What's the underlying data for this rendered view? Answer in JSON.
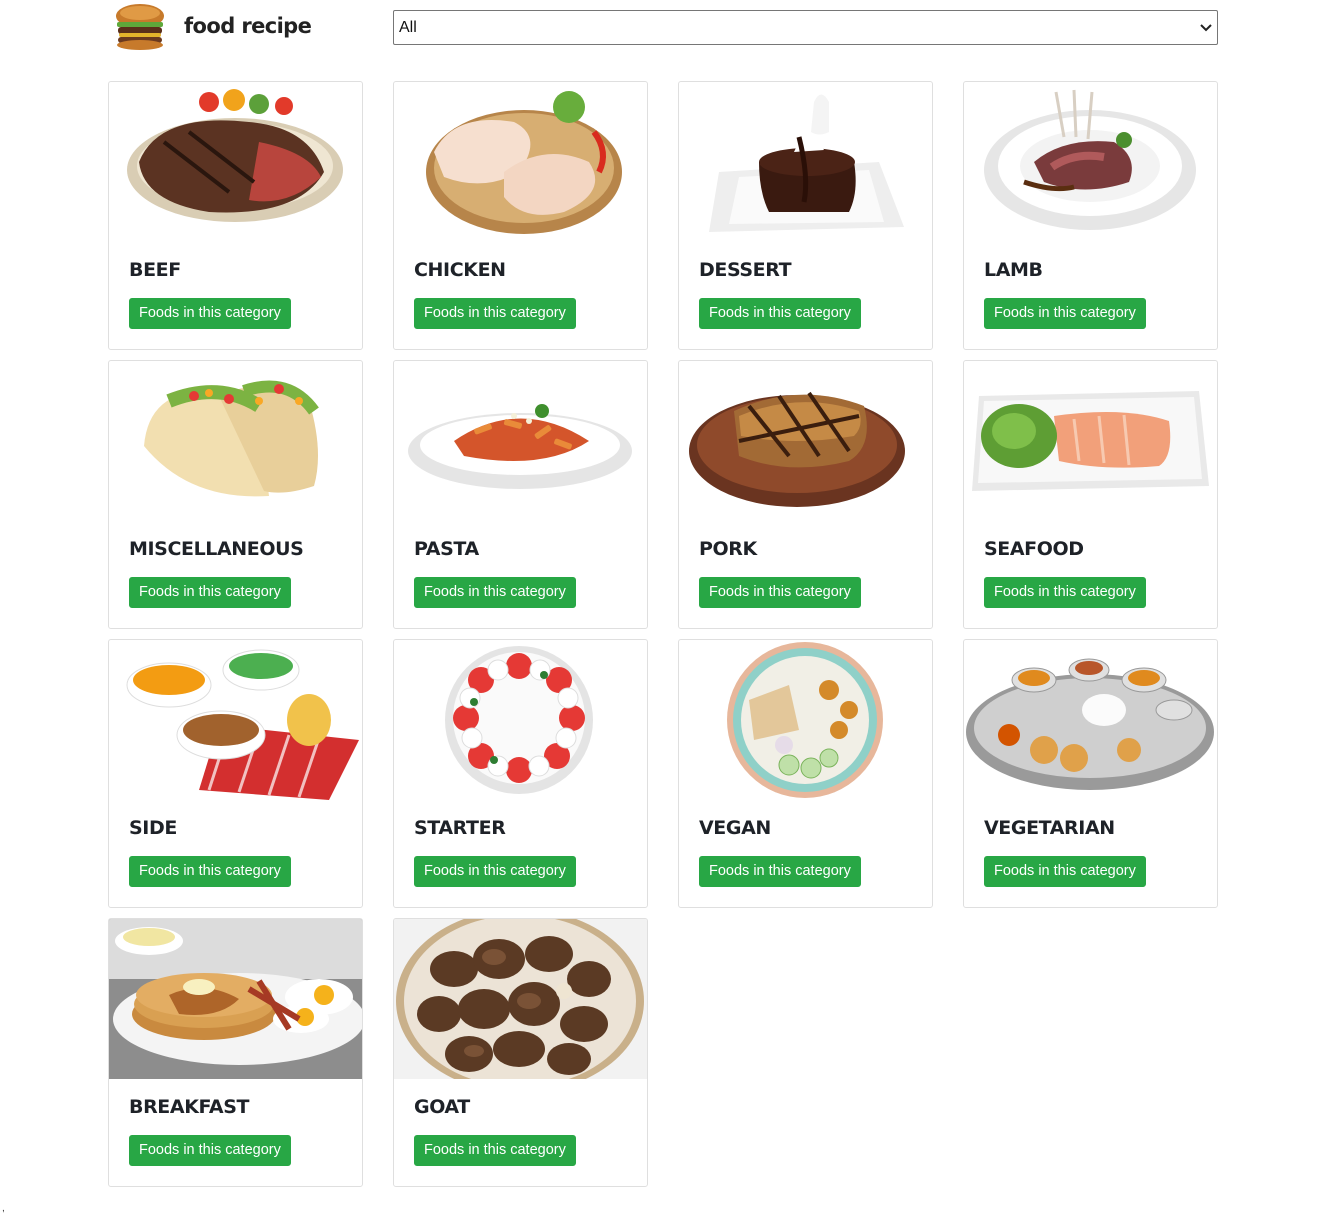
{
  "app": {
    "brand": "food recipe",
    "logo_icon": "burger-icon"
  },
  "filter": {
    "selected": "All",
    "options": [
      "All"
    ]
  },
  "colors": {
    "button_bg": "#28a745",
    "button_text": "#ffffff",
    "card_border": "#dfdfdf"
  },
  "categories": [
    {
      "name": "BEEF",
      "button": "Foods in this category",
      "image_icon": "steak-plate-image"
    },
    {
      "name": "CHICKEN",
      "button": "Foods in this category",
      "image_icon": "raw-chicken-image"
    },
    {
      "name": "DESSERT",
      "button": "Foods in this category",
      "image_icon": "chocolate-cake-image"
    },
    {
      "name": "LAMB",
      "button": "Foods in this category",
      "image_icon": "lamb-chops-image"
    },
    {
      "name": "MISCELLANEOUS",
      "button": "Foods in this category",
      "image_icon": "tacos-image"
    },
    {
      "name": "PASTA",
      "button": "Foods in this category",
      "image_icon": "penne-pasta-image"
    },
    {
      "name": "PORK",
      "button": "Foods in this category",
      "image_icon": "grilled-pork-image"
    },
    {
      "name": "SEAFOOD",
      "button": "Foods in this category",
      "image_icon": "salmon-plate-image"
    },
    {
      "name": "SIDE",
      "button": "Foods in this category",
      "image_icon": "side-dishes-image"
    },
    {
      "name": "STARTER",
      "button": "Foods in this category",
      "image_icon": "caprese-salad-image"
    },
    {
      "name": "VEGAN",
      "button": "Foods in this category",
      "image_icon": "vegan-bowl-image"
    },
    {
      "name": "VEGETARIAN",
      "button": "Foods in this category",
      "image_icon": "thali-platter-image"
    },
    {
      "name": "BREAKFAST",
      "button": "Foods in this category",
      "image_icon": "pancakes-breakfast-image"
    },
    {
      "name": "GOAT",
      "button": "Foods in this category",
      "image_icon": "goat-meat-image"
    }
  ],
  "footer": {
    "stray_text": ","
  }
}
